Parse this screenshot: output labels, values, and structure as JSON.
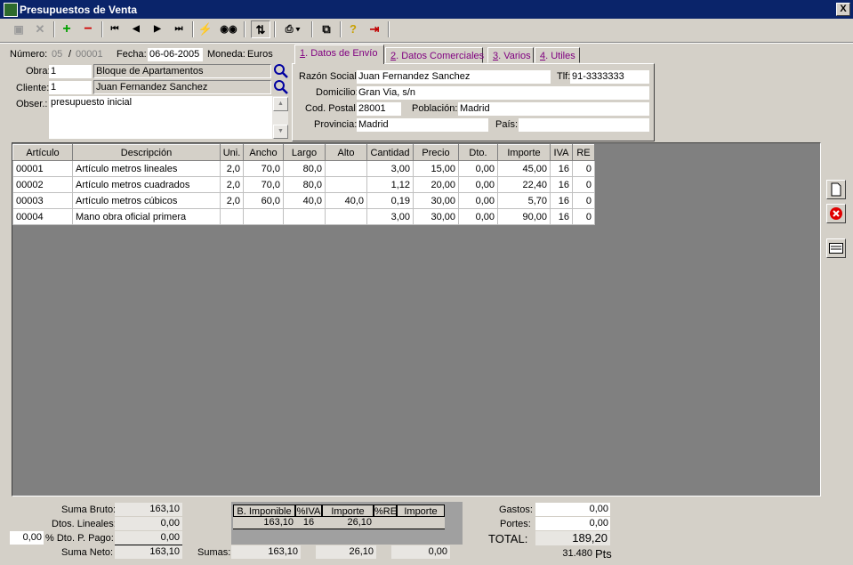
{
  "window": {
    "title": "Presupuestos de Venta",
    "close_label": "X"
  },
  "toolbar": {
    "icons": [
      "save-icon",
      "delete-icon",
      "add-icon",
      "remove-icon",
      "first-icon",
      "prev-icon",
      "next-icon",
      "last-icon",
      "lightning-icon",
      "binoculars-icon",
      "sort-icon",
      "print-icon",
      "copy-icon",
      "help-icon",
      "exit-icon"
    ],
    "add_label": "+",
    "remove_label": "−",
    "first_label": "⏮",
    "prev_label": "◀",
    "next_label": "▶",
    "last_label": "⏭",
    "lightning_label": "⚡",
    "binoculars_label": "👓",
    "sort_label": "⇅",
    "print_label": "🖶 ▾",
    "copy_label": "⧉",
    "help_label": "?",
    "exit_label": "⇥"
  },
  "header": {
    "numero_label": "Número:",
    "numero_serie": "05",
    "slash": "/",
    "numero": "00001",
    "fecha_label": "Fecha:",
    "fecha": "06-06-2005",
    "moneda_label": "Moneda:",
    "moneda": "Euros",
    "obra_label": "Obra:",
    "obra_code": "1",
    "obra_name": "Bloque de Apartamentos",
    "cliente_label": "Cliente:",
    "cliente_code": "1",
    "cliente_name": "Juan Fernandez Sanchez",
    "obser_label": "Obser.:",
    "obser": "presupuesto inicial"
  },
  "tabs": [
    {
      "key": "1",
      "label": ". Datos de Envío"
    },
    {
      "key": "2",
      "label": ". Datos Comerciales"
    },
    {
      "key": "3",
      "label": ". Varios"
    },
    {
      "key": "4",
      "label": ". Utiles"
    }
  ],
  "envio": {
    "razon_label": "Razón Social:",
    "razon": "Juan Fernandez Sanchez",
    "tlf_label": "Tlf:",
    "tlf": "91-3333333",
    "domicilio_label": "Domicilio:",
    "domicilio": "Gran Via, s/n",
    "cp_label": "Cod. Postal:",
    "cp": "28001",
    "poblacion_label": "Población:",
    "poblacion": "Madrid",
    "provincia_label": "Provincia:",
    "provincia": "Madrid",
    "pais_label": "País:",
    "pais": ""
  },
  "grid": {
    "columns": [
      "Artículo",
      "Descripción",
      "Uni.",
      "Ancho",
      "Largo",
      "Alto",
      "Cantidad",
      "Precio",
      "Dto.",
      "Importe",
      "IVA",
      "RE"
    ],
    "rows": [
      [
        "00001",
        "Artículo metros lineales",
        "2,0",
        "70,0",
        "80,0",
        "",
        "3,00",
        "15,00",
        "0,00",
        "45,00",
        "16",
        "0"
      ],
      [
        "00002",
        "Artículo metros cuadrados",
        "2,0",
        "70,0",
        "80,0",
        "",
        "1,12",
        "20,00",
        "0,00",
        "22,40",
        "16",
        "0"
      ],
      [
        "00003",
        "Artículo metros cúbicos",
        "2,0",
        "60,0",
        "40,0",
        "40,0",
        "0,19",
        "30,00",
        "0,00",
        "5,70",
        "16",
        "0"
      ],
      [
        "00004",
        "Mano obra oficial primera",
        "",
        "",
        "",
        "",
        "3,00",
        "30,00",
        "0,00",
        "90,00",
        "16",
        "0"
      ]
    ]
  },
  "totals": {
    "suma_bruto_label": "Suma Bruto:",
    "suma_bruto": "163,10",
    "dtos_lineales_label": "Dtos. Lineales:",
    "dtos_lineales": "0,00",
    "dto_pp_pct": "0,00",
    "dto_pp_label": "% Dto. P. Pago:",
    "dto_pp": "0,00",
    "suma_neto_label": "Suma Neto:",
    "suma_neto": "163,10",
    "vat_headers": [
      "B. Imponible",
      "%IVA",
      "Importe",
      "%RE",
      "Importe"
    ],
    "vat_row": [
      "163,10",
      "16",
      "26,10",
      "",
      ""
    ],
    "sumas_label": "Sumas:",
    "sumas_base": "163,10",
    "sumas_iva": "26,10",
    "sumas_re": "0,00",
    "gastos_label": "Gastos:",
    "gastos": "0,00",
    "portes_label": "Portes:",
    "portes": "0,00",
    "total_label": "TOTAL:",
    "total": "189,20",
    "pts": "31.480",
    "pts_unit": "Pts"
  }
}
